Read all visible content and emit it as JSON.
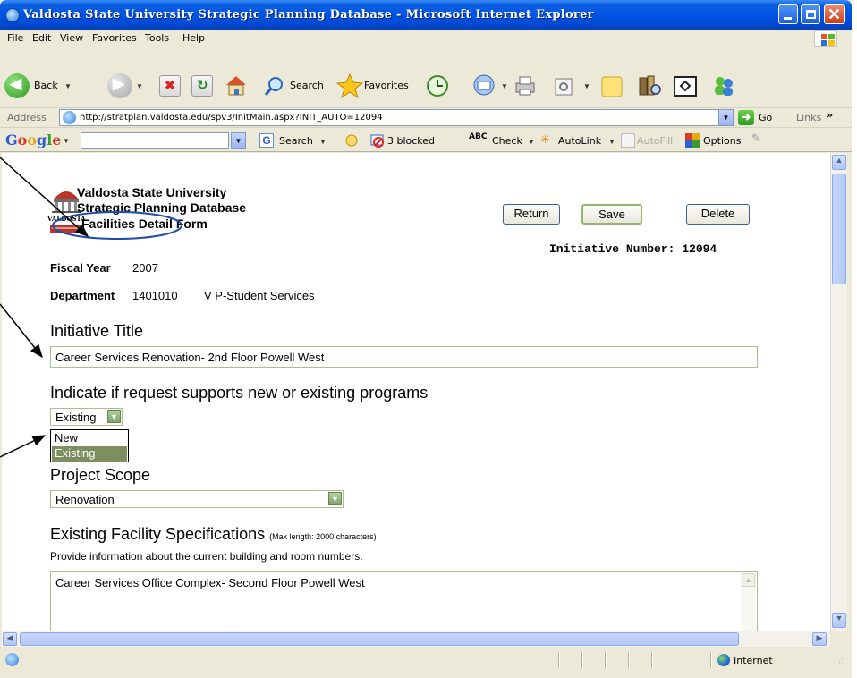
{
  "window": {
    "title": "Valdosta State University Strategic Planning Database - Microsoft Internet Explorer"
  },
  "menu": {
    "items": [
      "File",
      "Edit",
      "View",
      "Favorites",
      "Tools",
      "Help"
    ]
  },
  "toolbar": {
    "back_label": "Back",
    "search_label": "Search",
    "favorites_label": "Favorites"
  },
  "address": {
    "label": "Address",
    "url": "http://stratplan.valdosta.edu/spv3/InitMain.aspx?INIT_AUTO=12094",
    "go_label": "Go",
    "links_label": "Links"
  },
  "google_bar": {
    "logo": "Google",
    "search_label": "Search",
    "blocked_label": "3 blocked",
    "check_label": "Check",
    "autolink_label": "AutoLink",
    "autofill_label": "AutoFill",
    "options_label": "Options"
  },
  "status": {
    "zone": "Internet"
  },
  "page": {
    "logo_text": "VALDOSTA",
    "header": [
      "Valdosta State University",
      "Strategic Planning Database",
      "Facilities Detail Form"
    ],
    "buttons": {
      "return": "Return",
      "save": "Save",
      "delete": "Delete"
    },
    "initiative_number": "Initiative Number: 12094",
    "fiscal_year_label": "Fiscal Year",
    "fiscal_year": "2007",
    "department_label": "Department",
    "department_code": "1401010",
    "department_name": "V P-Student Services",
    "initiative_title_label": "Initiative Title",
    "initiative_title": "Career Services Renovation- 2nd Floor Powell West",
    "program_question": "Indicate if request supports new or existing programs",
    "program_selected": "Existing",
    "program_options": [
      "New",
      "Existing"
    ],
    "project_scope_label": "Project Scope",
    "project_scope": "Renovation",
    "facility_specs_label": "Existing Facility Specifications",
    "facility_specs_note": "(Max length: 2000 characters)",
    "facility_specs_help": "Provide information about the current building and room numbers.",
    "facility_specs_value": "Career Services Office Complex- Second Floor Powell West"
  },
  "colors": {
    "titlebar": "#0054e3",
    "field_border": "#a8c08e",
    "selected_option": "#7d8f5e",
    "annotation_circle": "#1f4aa8"
  }
}
